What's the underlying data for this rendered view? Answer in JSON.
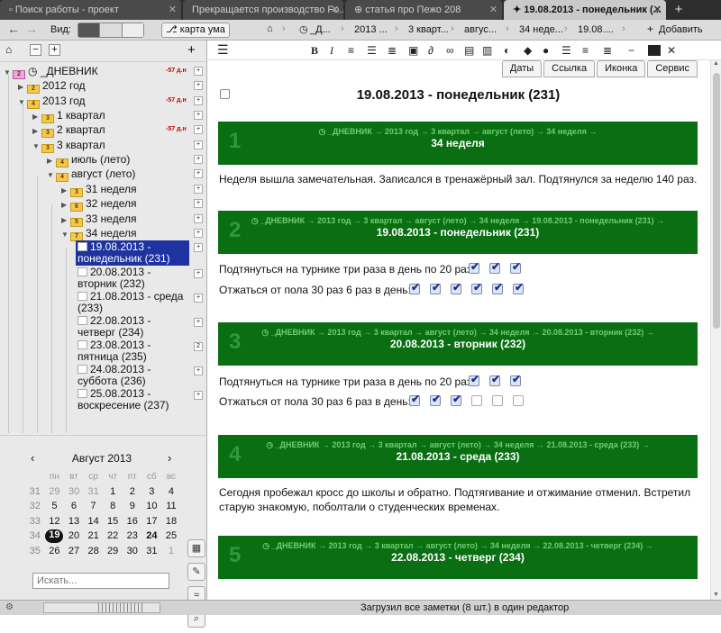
{
  "tabs": [
    {
      "label": "Поиск работы - проект",
      "icon": "page-icon"
    },
    {
      "label": "Прекращается производство Fo...",
      "icon": "page-icon"
    },
    {
      "label": "статья про Пежо 208",
      "icon": "globe-icon"
    },
    {
      "label": "19.08.2013 - понедельник (...",
      "icon": "pin-icon"
    }
  ],
  "toolbar": {
    "view_label": "Вид:",
    "mindmap_label": "карта ума",
    "breadcrumbs": [
      "_Д...",
      "2013 ...",
      "3 кварт...",
      "авгус...",
      "34 неде...",
      "19.08...."
    ],
    "add_label": "Добавить"
  },
  "tree": {
    "nodes": [
      {
        "label": "_ДНЕВНИК",
        "badge": "-57 д.н",
        "box": "+"
      },
      {
        "label": "2012 год",
        "fold_num": "2",
        "box": "+"
      },
      {
        "label": "2013 год",
        "fold_num": "4",
        "badge": "-57 д.н",
        "box": "+"
      },
      {
        "label": "1 квартал",
        "fold_num": "3",
        "box": "+"
      },
      {
        "label": "2 квартал",
        "fold_num": "3",
        "badge": "-57 д.н",
        "box": "+"
      },
      {
        "label": "3 квартал",
        "fold_num": "3",
        "box": "+"
      },
      {
        "label": "июль (лето)",
        "fold_num": "4",
        "box": "+"
      },
      {
        "label": "август (лето)",
        "fold_num": "4",
        "box": "+"
      },
      {
        "label": "31 неделя",
        "fold_num": "3",
        "box": "+"
      },
      {
        "label": "32 неделя",
        "fold_num": "6",
        "box": "+"
      },
      {
        "label": "33 неделя",
        "fold_num": "5",
        "box": "+"
      },
      {
        "label": "34 неделя",
        "fold_num": "7",
        "box": "+"
      },
      {
        "line1": "19.08.2013 -",
        "line2": "понедельник (231)",
        "box": "+"
      },
      {
        "line1": "20.08.2013 -",
        "line2": "вторник (232)",
        "box": "+"
      },
      {
        "line1": "21.08.2013 - среда",
        "line2": "(233)",
        "box": "+"
      },
      {
        "line1": "22.08.2013 -",
        "line2": "четверг (234)",
        "box": "+"
      },
      {
        "line1": "23.08.2013 -",
        "line2": "пятница (235)",
        "box": "2"
      },
      {
        "line1": "24.08.2013 -",
        "line2": "суббота (236)",
        "box": "+"
      },
      {
        "line1": "25.08.2013 -",
        "line2": "воскресение (237)",
        "box": "+"
      }
    ]
  },
  "calendar": {
    "title": "Август 2013",
    "dow": [
      "пн",
      "вт",
      "ср",
      "чт",
      "пт",
      "сб",
      "вс"
    ],
    "weeks": [
      {
        "wk": "31",
        "days": [
          "29",
          "30",
          "31",
          "1",
          "2",
          "3",
          "4"
        ]
      },
      {
        "wk": "32",
        "days": [
          "5",
          "6",
          "7",
          "8",
          "9",
          "10",
          "11"
        ]
      },
      {
        "wk": "33",
        "days": [
          "12",
          "13",
          "14",
          "15",
          "16",
          "17",
          "18"
        ]
      },
      {
        "wk": "34",
        "days": [
          "19",
          "20",
          "21",
          "22",
          "23",
          "24",
          "25"
        ]
      },
      {
        "wk": "35",
        "days": [
          "26",
          "27",
          "28",
          "29",
          "30",
          "31",
          "1"
        ]
      }
    ]
  },
  "search": {
    "placeholder": "Искать..."
  },
  "subtabs": [
    "Даты",
    "Ссылка",
    "Иконка",
    "Сервис"
  ],
  "format_bar": {
    "bold": "B",
    "italic": "I"
  },
  "document": {
    "title": "19.08.2013 - понедельник (231)",
    "entries": [
      {
        "num": "1",
        "path": "_ДНЕВНИК → 2013 год → 3 квартал → август (лето) → 34 неделя →",
        "title": "34 неделя"
      },
      {
        "num": "2",
        "path": "_ДНЕВНИК → 2013 год → 3 квартал → август (лето) → 34 неделя → 19.08.2013 - понедельник (231) →",
        "title": "19.08.2013 - понедельник (231)"
      },
      {
        "num": "3",
        "path": "_ДНЕВНИК → 2013 год → 3 квартал → август (лето) → 34 неделя → 20.08.2013 - вторник (232) →",
        "title": "20.08.2013 - вторник (232)"
      },
      {
        "num": "4",
        "path": "_ДНЕВНИК → 2013 год → 3 квартал → август (лето) → 34 неделя → 21.08.2013 - среда (233) →",
        "title": "21.08.2013 - среда (233)"
      },
      {
        "num": "5",
        "path": "_ДНЕВНИК → 2013 год → 3 квартал → август (лето) → 34 неделя → 22.08.2013 - четверг (234) →",
        "title": "22.08.2013 - четверг (234)"
      }
    ],
    "para1": "Неделя вышла замечательная. Записался в тренажёрный зал. Подтянулся за неделю 140 раз.",
    "para4": "Сегодня пробежал кросс до школы и обратно. Подтягивание и отжимание отменил. Встретил старую знакомую, поболтали о студенческих временах.",
    "day231": {
      "pullups_label": "Подтянуться на турнике три раза в день по 20 раз:",
      "pullups": [
        true,
        true,
        true
      ],
      "pushups_label": "Отжаться от пола 30 раз 6 раз в день:",
      "pushups": [
        true,
        true,
        true,
        true,
        true,
        true
      ]
    },
    "day232": {
      "pullups_label": "Подтянуться на турнике три раза в день по 20 раз:",
      "pullups": [
        true,
        true,
        true
      ],
      "pushups_label": "Отжаться от пола 30 раз 6 раз в день:",
      "pushups": [
        true,
        true,
        true,
        false,
        false,
        false
      ]
    }
  },
  "status": {
    "message": "Загрузил все заметки (8 шт.) в один редактор"
  }
}
